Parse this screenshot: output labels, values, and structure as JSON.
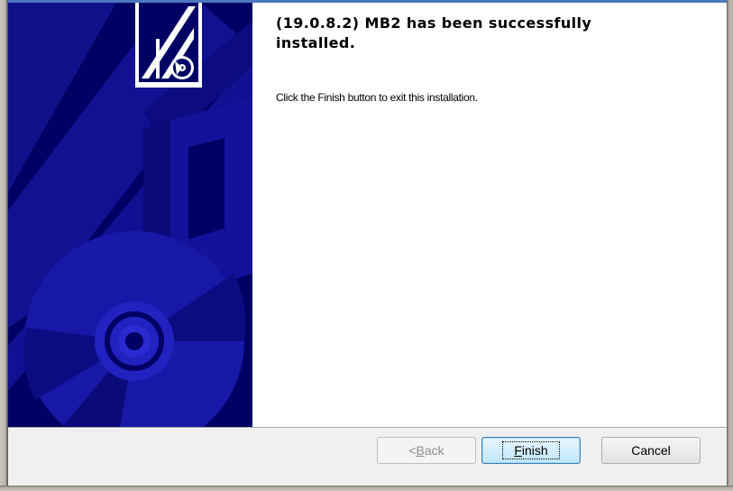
{
  "installer": {
    "title_line_1": "(19.0.8.2) MB2 has been successfully",
    "title_line_2": "installed.",
    "message": "Click the Finish button to exit this installation."
  },
  "buttons": {
    "back": {
      "prefix": "< ",
      "mnemonic": "B",
      "rest": "ack",
      "enabled": false
    },
    "finish": {
      "mnemonic": "F",
      "rest": "inish",
      "is_default": true
    },
    "cancel": {
      "label": "Cancel"
    }
  },
  "colors": {
    "banner_bg": "#000064",
    "banner_art": "#1a1ab4",
    "accent_border": "#3c7fb1"
  },
  "icons": [
    "installer-logo-icon",
    "cd-disc-icon"
  ]
}
